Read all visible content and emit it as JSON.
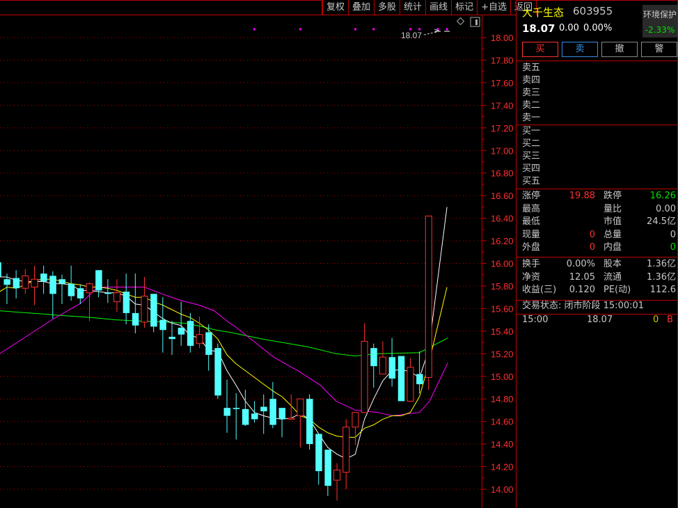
{
  "toolbar": {
    "items": [
      "复权",
      "叠加",
      "多股",
      "统计",
      "画线",
      "标记",
      "+自选",
      "返回"
    ]
  },
  "quote": {
    "name": "大千生态",
    "code": "603955",
    "price": "18.07",
    "change": "0.00",
    "change_pct": "0.00%",
    "sector_name": "环境保护",
    "sector_change": "-2.33%"
  },
  "trade_buttons": {
    "buy": "买",
    "sell": "卖",
    "cancel": "撤",
    "alert": "警"
  },
  "order_book": {
    "asks": [
      "卖五",
      "卖四",
      "卖三",
      "卖二",
      "卖一"
    ],
    "bids": [
      "买一",
      "买二",
      "买三",
      "买四",
      "买五"
    ]
  },
  "stats1": [
    {
      "l1": "涨停",
      "v1": "19.88",
      "c1": "red",
      "l2": "跌停",
      "v2": "16.26",
      "c2": "green"
    },
    {
      "l1": "最高",
      "v1": "",
      "c1": "white",
      "l2": "量比",
      "v2": "0.00",
      "c2": "white"
    },
    {
      "l1": "最低",
      "v1": "",
      "c1": "white",
      "l2": "市值",
      "v2": "24.5亿",
      "c2": "white"
    },
    {
      "l1": "现量",
      "v1": "0",
      "c1": "red",
      "l2": "总量",
      "v2": "0",
      "c2": "white"
    },
    {
      "l1": "外盘",
      "v1": "0",
      "c1": "red",
      "l2": "内盘",
      "v2": "0",
      "c2": "green"
    }
  ],
  "stats2": [
    {
      "l1": "换手",
      "v1": "0.00%",
      "c1": "white",
      "l2": "股本",
      "v2": "1.36亿",
      "c2": "white"
    },
    {
      "l1": "净资",
      "v1": "12.05",
      "c1": "white",
      "l2": "流通",
      "v2": "1.36亿",
      "c2": "white"
    },
    {
      "l1": "收益(三)",
      "v1": "0.120",
      "c1": "white",
      "l2": "PE(动)",
      "v2": "112.6",
      "c2": "white"
    }
  ],
  "trade_status": "交易状态: 闭市阶段 15:00:01",
  "ticks": [
    {
      "time": "15:00",
      "price": "18.07",
      "volume": "0",
      "side": "B"
    }
  ],
  "chart_annotation": "18.07",
  "colors": {
    "up": "#ff3030",
    "down": "#54ffff",
    "grid": "#c00000",
    "ma5": "#ffffff",
    "ma10": "#ffff00",
    "ma20": "#ff00ff",
    "ma60": "#00ff00"
  },
  "chart_data": {
    "type": "candlestick",
    "ylim": [
      14.0,
      18.0
    ],
    "y_ticks": [
      "18.00",
      "17.80",
      "17.60",
      "17.40",
      "17.20",
      "17.00",
      "16.80",
      "16.60",
      "16.40",
      "16.20",
      "16.00",
      "15.80",
      "15.60",
      "15.40",
      "15.20",
      "15.00",
      "14.80",
      "14.60",
      "14.40",
      "14.20",
      "14.00"
    ],
    "ohlc": [
      [
        16.01,
        16.01,
        15.85,
        15.88
      ],
      [
        15.86,
        15.91,
        15.64,
        15.81
      ],
      [
        15.87,
        15.94,
        15.69,
        15.78
      ],
      [
        15.78,
        15.95,
        15.73,
        15.89
      ],
      [
        15.79,
        15.98,
        15.63,
        15.86
      ],
      [
        15.91,
        15.98,
        15.73,
        15.84
      ],
      [
        15.89,
        15.93,
        15.51,
        15.73
      ],
      [
        15.86,
        15.9,
        15.64,
        15.82
      ],
      [
        15.82,
        15.98,
        15.67,
        15.71
      ],
      [
        15.78,
        15.81,
        15.64,
        15.69
      ],
      [
        15.74,
        15.83,
        15.49,
        15.82
      ],
      [
        15.94,
        15.94,
        15.7,
        15.76
      ],
      [
        15.74,
        15.86,
        15.65,
        15.73
      ],
      [
        15.66,
        15.86,
        15.57,
        15.74
      ],
      [
        15.75,
        15.91,
        15.46,
        15.56
      ],
      [
        15.56,
        15.91,
        15.38,
        15.45
      ],
      [
        15.48,
        15.88,
        15.43,
        15.71
      ],
      [
        15.73,
        15.73,
        15.39,
        15.44
      ],
      [
        15.5,
        15.7,
        15.21,
        15.41
      ],
      [
        15.35,
        15.49,
        15.19,
        15.33
      ],
      [
        15.43,
        15.66,
        15.27,
        15.37
      ],
      [
        15.49,
        15.56,
        15.21,
        15.27
      ],
      [
        15.29,
        15.53,
        15.25,
        15.37
      ],
      [
        15.39,
        15.46,
        15.05,
        15.19
      ],
      [
        15.25,
        15.29,
        14.8,
        14.83
      ],
      [
        14.72,
        14.97,
        14.5,
        14.65
      ],
      [
        14.72,
        14.85,
        14.44,
        14.71
      ],
      [
        14.71,
        14.88,
        14.56,
        14.57
      ],
      [
        14.67,
        14.78,
        14.59,
        14.62
      ],
      [
        14.73,
        14.84,
        14.49,
        14.69
      ],
      [
        14.8,
        14.95,
        14.54,
        14.57
      ],
      [
        14.72,
        14.72,
        14.46,
        14.62
      ],
      [
        14.62,
        14.84,
        14.62,
        14.63
      ],
      [
        14.65,
        14.8,
        14.37,
        14.8
      ],
      [
        14.8,
        14.84,
        14.35,
        14.4
      ],
      [
        14.49,
        14.49,
        14.04,
        14.16
      ],
      [
        14.35,
        14.35,
        13.94,
        14.03
      ],
      [
        14.08,
        14.23,
        13.9,
        14.17
      ],
      [
        14.15,
        14.62,
        14.0,
        14.55
      ],
      [
        14.55,
        14.68,
        14.39,
        14.68
      ],
      [
        14.68,
        15.47,
        14.68,
        15.31
      ],
      [
        15.25,
        15.29,
        14.9,
        15.09
      ],
      [
        15.02,
        15.31,
        15.02,
        15.17
      ],
      [
        15.17,
        15.34,
        14.91,
        14.98
      ],
      [
        15.18,
        15.18,
        14.78,
        14.78
      ],
      [
        14.78,
        15.16,
        14.78,
        15.08
      ],
      [
        15.02,
        15.22,
        14.85,
        14.93
      ],
      [
        14.99,
        16.42,
        14.88,
        16.42
      ]
    ],
    "ma5": [
      [
        0,
        15.88
      ],
      [
        1,
        15.88
      ],
      [
        2,
        15.85
      ],
      [
        3,
        15.84
      ],
      [
        4,
        15.84
      ],
      [
        5,
        15.84
      ],
      [
        6,
        15.82
      ],
      [
        7,
        15.82
      ],
      [
        8,
        15.81
      ],
      [
        9,
        15.76
      ],
      [
        10,
        15.76
      ],
      [
        11,
        15.75
      ],
      [
        12,
        15.74
      ],
      [
        13,
        15.74
      ],
      [
        14,
        15.71
      ],
      [
        15,
        15.64
      ],
      [
        16,
        15.63
      ],
      [
        17,
        15.57
      ],
      [
        18,
        15.51
      ],
      [
        19,
        15.47
      ],
      [
        20,
        15.45
      ],
      [
        21,
        15.36
      ],
      [
        22,
        15.34
      ],
      [
        23,
        15.23
      ],
      [
        24,
        15.22
      ],
      [
        25,
        15.05
      ],
      [
        26,
        14.92
      ],
      [
        27,
        14.78
      ],
      [
        28,
        14.68
      ],
      [
        29,
        14.65
      ],
      [
        30,
        14.63
      ],
      [
        31,
        14.62
      ],
      [
        32,
        14.63
      ],
      [
        33,
        14.67
      ],
      [
        34,
        14.62
      ],
      [
        35,
        14.49
      ],
      [
        36,
        14.37
      ],
      [
        37,
        14.31
      ],
      [
        38,
        14.27
      ],
      [
        39,
        14.31
      ],
      [
        40,
        14.62
      ],
      [
        41,
        14.8
      ],
      [
        42,
        14.96
      ],
      [
        43,
        15.05
      ],
      [
        44,
        15.06
      ],
      [
        45,
        15.04
      ],
      [
        46,
        14.99
      ],
      [
        47,
        15.23
      ],
      [
        49,
        16.5
      ]
    ],
    "ma10": [
      [
        0,
        15.74
      ],
      [
        1,
        15.79
      ],
      [
        2,
        15.78
      ],
      [
        3,
        15.81
      ],
      [
        4,
        15.85
      ],
      [
        5,
        15.86
      ],
      [
        6,
        15.86
      ],
      [
        7,
        15.84
      ],
      [
        8,
        15.82
      ],
      [
        9,
        15.81
      ],
      [
        10,
        15.79
      ],
      [
        11,
        15.79
      ],
      [
        12,
        15.78
      ],
      [
        13,
        15.76
      ],
      [
        14,
        15.73
      ],
      [
        15,
        15.7
      ],
      [
        16,
        15.7
      ],
      [
        17,
        15.66
      ],
      [
        18,
        15.63
      ],
      [
        19,
        15.59
      ],
      [
        20,
        15.55
      ],
      [
        21,
        15.52
      ],
      [
        22,
        15.47
      ],
      [
        23,
        15.41
      ],
      [
        24,
        15.33
      ],
      [
        25,
        15.19
      ],
      [
        26,
        15.11
      ],
      [
        27,
        15.05
      ],
      [
        28,
        14.99
      ],
      [
        29,
        14.93
      ],
      [
        30,
        14.87
      ],
      [
        31,
        14.82
      ],
      [
        32,
        14.74
      ],
      [
        33,
        14.65
      ],
      [
        34,
        14.62
      ],
      [
        35,
        14.55
      ],
      [
        36,
        14.5
      ],
      [
        37,
        14.47
      ],
      [
        38,
        14.46
      ],
      [
        39,
        14.46
      ],
      [
        40,
        14.54
      ],
      [
        41,
        14.57
      ],
      [
        42,
        14.62
      ],
      [
        43,
        14.65
      ],
      [
        44,
        14.65
      ],
      [
        45,
        14.68
      ],
      [
        46,
        14.82
      ],
      [
        47,
        15.11
      ],
      [
        49,
        15.79
      ]
    ],
    "ma20": [
      [
        0.2,
        15.2
      ],
      [
        6.1,
        15.51
      ],
      [
        9.1,
        15.65
      ],
      [
        10.9,
        15.79
      ],
      [
        16.0,
        15.79
      ],
      [
        17.9,
        15.73
      ],
      [
        20.0,
        15.67
      ],
      [
        22.0,
        15.63
      ],
      [
        23.6,
        15.58
      ],
      [
        25.3,
        15.47
      ],
      [
        25.9,
        15.44
      ],
      [
        30.1,
        15.17
      ],
      [
        32.7,
        15.05
      ],
      [
        35.2,
        14.92
      ],
      [
        36.9,
        14.78
      ],
      [
        39.0,
        14.7
      ],
      [
        41.5,
        14.68
      ],
      [
        43.0,
        14.65
      ],
      [
        46.0,
        14.68
      ],
      [
        47.1,
        14.78
      ],
      [
        49.1,
        15.12
      ]
    ],
    "ma60": [
      [
        0.2,
        15.58
      ],
      [
        3.5,
        15.56
      ],
      [
        5.3,
        15.55
      ],
      [
        6.6,
        15.54
      ],
      [
        8.6,
        15.53
      ],
      [
        10.3,
        15.52
      ],
      [
        12.9,
        15.5
      ],
      [
        15.4,
        15.49
      ],
      [
        18.5,
        15.48
      ],
      [
        20.5,
        15.47
      ],
      [
        22.3,
        15.44
      ],
      [
        23.8,
        15.41
      ],
      [
        25.3,
        15.39
      ],
      [
        28.9,
        15.33
      ],
      [
        33.9,
        15.26
      ],
      [
        36.9,
        15.2
      ],
      [
        39.0,
        15.18
      ],
      [
        41.5,
        15.2
      ],
      [
        46.0,
        15.21
      ],
      [
        49.1,
        15.34
      ]
    ],
    "event_markers": [
      28,
      33,
      39,
      41,
      45,
      46,
      48,
      49
    ]
  }
}
